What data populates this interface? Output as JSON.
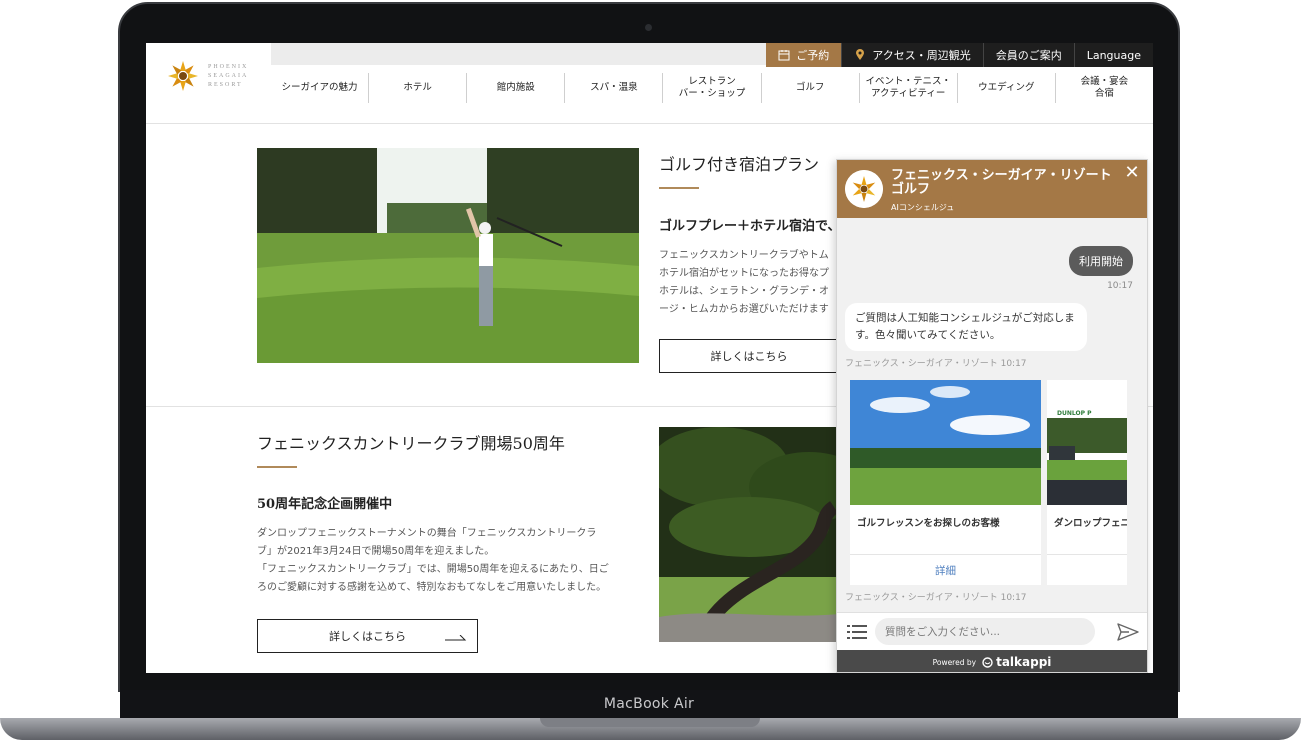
{
  "device": {
    "label": "MacBook Air"
  },
  "header": {
    "logo_text": "PHOENIX\nSEAGAIA\nRESORT",
    "utility": [
      {
        "label": "ご予約",
        "icon": "calendar-icon"
      },
      {
        "label": "アクセス・周辺観光",
        "icon": "map-pin-icon"
      },
      {
        "label": "会員のご案内"
      },
      {
        "label": "Language"
      }
    ],
    "nav": [
      "シーガイアの魅力",
      "ホテル",
      "館内施設",
      "スパ・温泉",
      "レストラン\nバー・ショップ",
      "ゴルフ",
      "イベント・テニス・\nアクティビティー",
      "ウエディング",
      "会議・宴会\n合宿"
    ]
  },
  "sections": [
    {
      "title": "ゴルフ付き宿泊プラン",
      "subtitle": "ゴルフプレー＋ホテル宿泊で、",
      "lines": [
        "フェニックスカントリークラブやトム",
        "ホテル宿泊がセットになったお得なプ",
        "ホテルは、シェラトン・グランデ・オ",
        "ージ・ヒムカからお選びいただけます"
      ],
      "button": "詳しくはこちら"
    },
    {
      "title": "フェニックスカントリークラブ開場50周年",
      "subtitle": "50周年記念企画開催中",
      "lines": [
        "ダンロップフェニックストーナメントの舞台「フェニックスカントリークラ",
        "ブ」が2021年3月24日で開場50周年を迎えました。",
        "「フェニックスカントリークラブ」では、開場50周年を迎えるにあたり、日ご",
        "ろのご愛顧に対する感謝を込めて、特別なおもてなしをご用意いたしました。"
      ],
      "button": "詳しくはこちら"
    }
  ],
  "chat": {
    "title": "フェニックス・シーガイア・リゾート ゴルフ",
    "subtitle": "AIコンシェルジュ",
    "user_message": "利用開始",
    "user_time": "10:17",
    "bot_message": "ご質問は人工知能コンシェルジュがご対応します。色々聞いてみてください。",
    "bot_meta": "フェニックス・シーガイア・リゾート  10:17",
    "cards": [
      {
        "label": "ゴルフレッスンをお探しのお客様",
        "button": "詳細"
      },
      {
        "label": "ダンロップフェニ",
        "sign": "DUNLOP P"
      }
    ],
    "cards_meta": "フェニックス・シーガイア・リゾート  10:17",
    "input_placeholder": "質問をご入力ください...",
    "powered_by": "Powered by",
    "brand": "talkappi"
  },
  "colors": {
    "accent": "#a47846",
    "divider_accent": "#b08a5a",
    "link": "#4f7fbf",
    "dark_bar": "#1e1e1e"
  }
}
